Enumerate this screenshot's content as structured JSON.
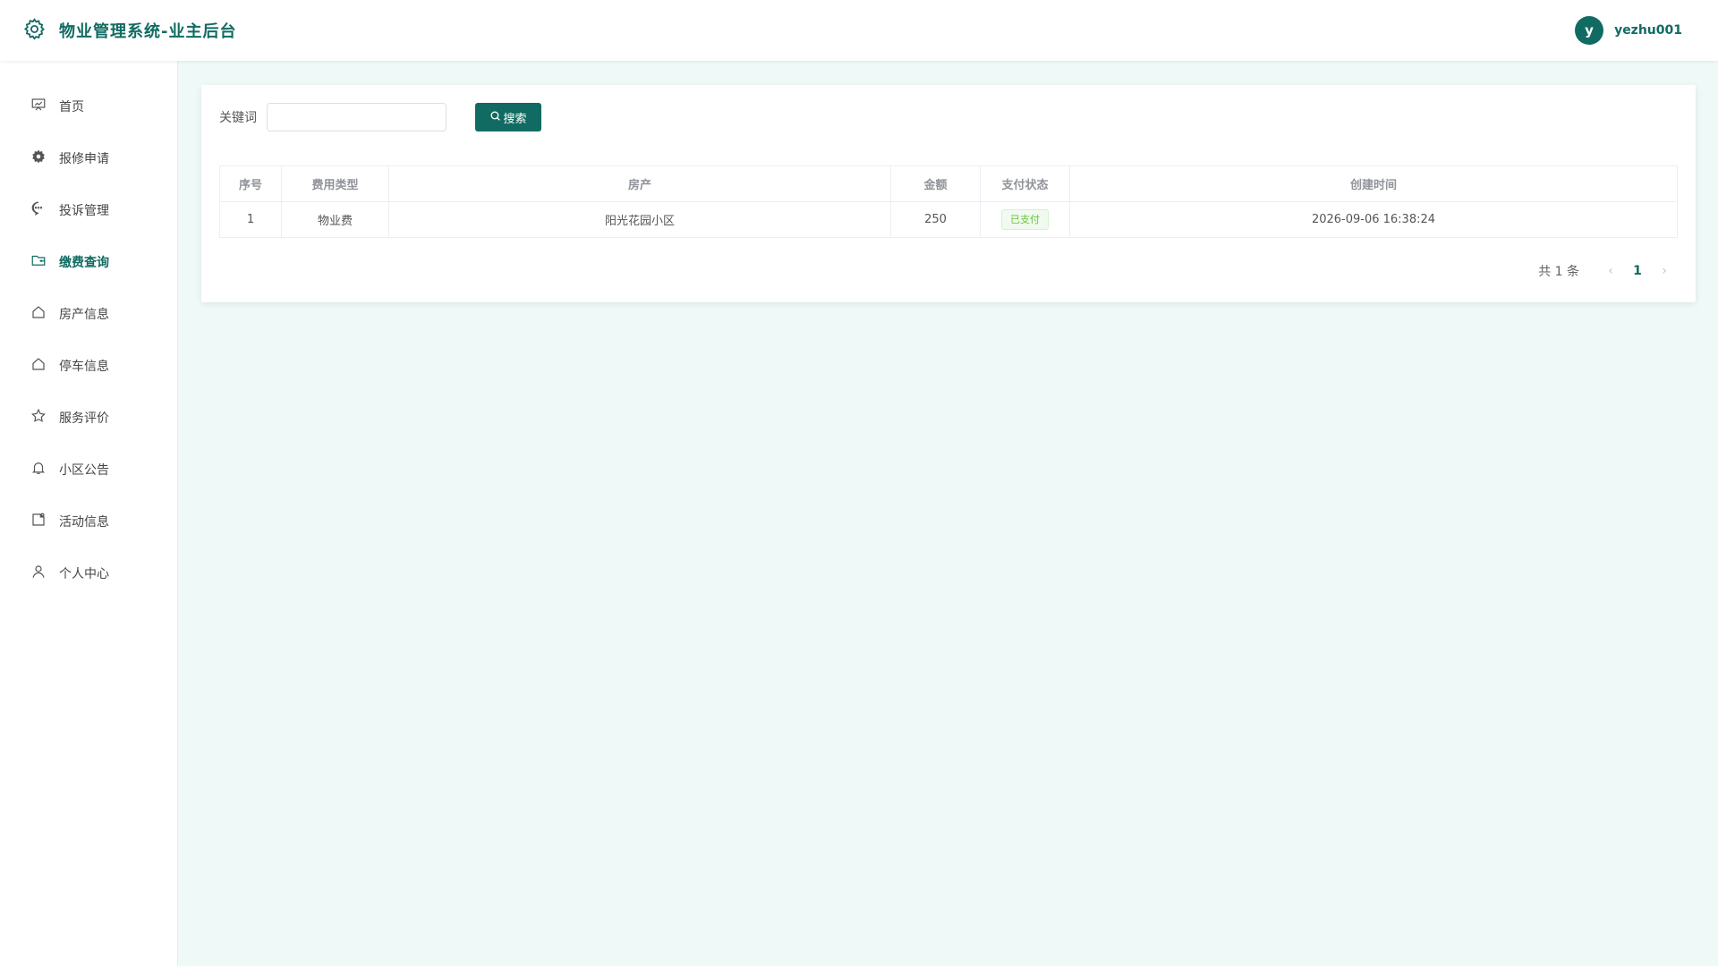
{
  "header": {
    "title": "物业管理系统-业主后台",
    "avatar_letter": "y",
    "username": "yezhu001"
  },
  "sidebar": {
    "items": [
      {
        "label": "首页",
        "icon": "chart-board-icon"
      },
      {
        "label": "报修申请",
        "icon": "gear-icon"
      },
      {
        "label": "投诉管理",
        "icon": "chat-bubble-icon"
      },
      {
        "label": "缴费查询",
        "icon": "wallet-icon"
      },
      {
        "label": "房产信息",
        "icon": "house-icon"
      },
      {
        "label": "停车信息",
        "icon": "house-icon"
      },
      {
        "label": "服务评价",
        "icon": "star-icon"
      },
      {
        "label": "小区公告",
        "icon": "bell-icon"
      },
      {
        "label": "活动信息",
        "icon": "note-icon"
      },
      {
        "label": "个人中心",
        "icon": "user-icon"
      }
    ],
    "active": "缴费查询"
  },
  "search": {
    "label": "关键词",
    "value": "",
    "placeholder": "",
    "button_label": "搜索"
  },
  "table": {
    "headers": [
      "序号",
      "费用类型",
      "房产",
      "金额",
      "支付状态",
      "创建时间"
    ],
    "rows": [
      {
        "index": "1",
        "fee_type": "物业费",
        "property": "阳光花园小区",
        "amount": "250",
        "status": "已支付",
        "created": "2026-09-06 16:38:24"
      }
    ]
  },
  "pagination": {
    "total_text": "共 1 条",
    "current_page": "1",
    "prev_icon": "chevron-left-icon",
    "next_icon": "chevron-right-icon"
  },
  "colors": {
    "primary": "#116b62",
    "background": "#eff9f7",
    "success": "#67c23a"
  }
}
